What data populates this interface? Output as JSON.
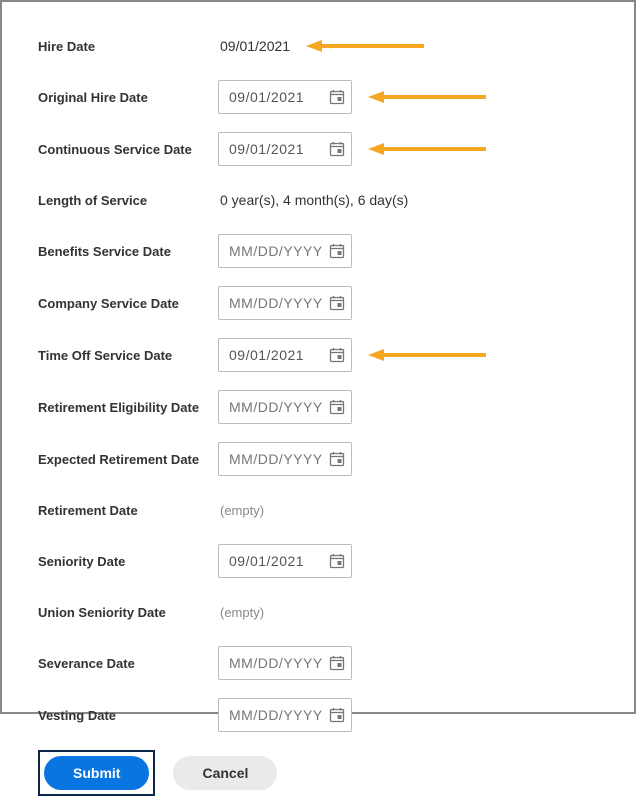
{
  "placeholders": {
    "date": "MM/DD/YYYY"
  },
  "values": {
    "hireDate": "09/01/2021",
    "originalHireDate": "09/01/2021",
    "continuousServiceDate": "09/01/2021",
    "lengthOfService": "0 year(s), 4 month(s), 6 day(s)",
    "timeOffServiceDate": "09/01/2021",
    "retirementDate": "(empty)",
    "seniorityDate": "09/01/2021",
    "unionSeniorityDate": "(empty)"
  },
  "labels": {
    "hireDate": "Hire Date",
    "originalHireDate": "Original Hire Date",
    "continuousServiceDate": "Continuous Service Date",
    "lengthOfService": "Length of Service",
    "benefitsServiceDate": "Benefits Service Date",
    "companyServiceDate": "Company Service Date",
    "timeOffServiceDate": "Time Off Service Date",
    "retirementEligibilityDate": "Retirement Eligibility Date",
    "expectedRetirementDate": "Expected Retirement Date",
    "retirementDate": "Retirement Date",
    "seniorityDate": "Seniority Date",
    "unionSeniorityDate": "Union Seniority Date",
    "severanceDate": "Severance Date",
    "vestingDate": "Vesting Date"
  },
  "buttons": {
    "submit": "Submit",
    "cancel": "Cancel"
  }
}
